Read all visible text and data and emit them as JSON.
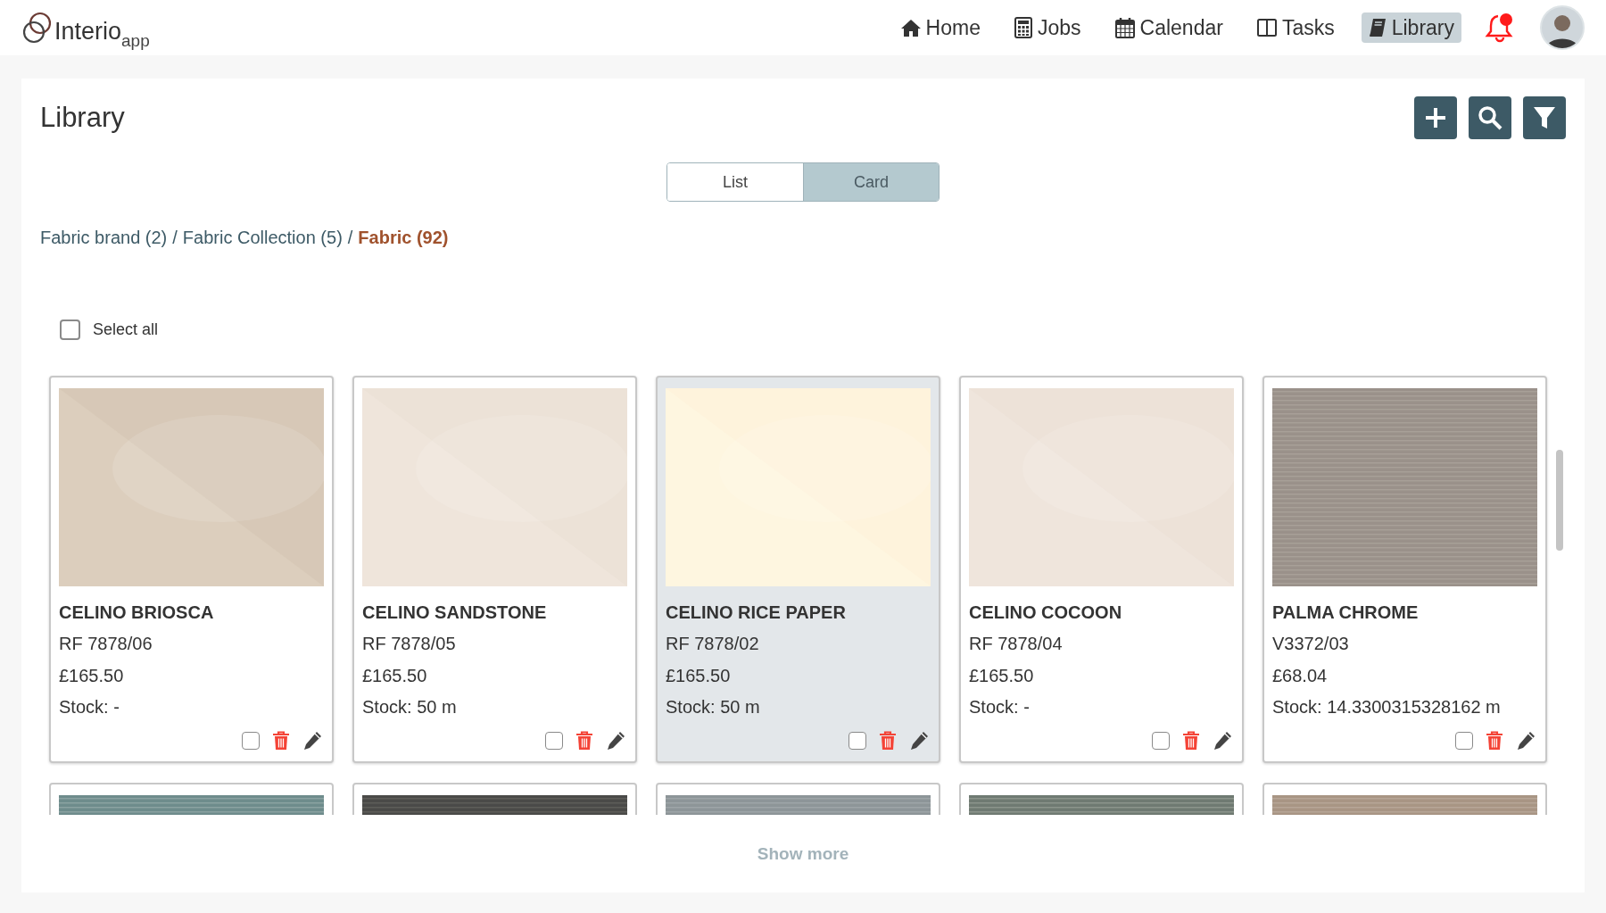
{
  "logo": {
    "name": "Interio",
    "suffix": "app"
  },
  "nav": [
    {
      "label": "Home",
      "selected": false
    },
    {
      "label": "Jobs",
      "selected": false
    },
    {
      "label": "Calendar",
      "selected": false
    },
    {
      "label": "Tasks",
      "selected": false
    },
    {
      "label": "Library",
      "selected": true
    }
  ],
  "notifications": {
    "unread": true
  },
  "page": {
    "title": "Library"
  },
  "view_toggle": [
    {
      "label": "List",
      "selected": false
    },
    {
      "label": "Card",
      "selected": true
    }
  ],
  "breadcrumb": [
    {
      "label": "Fabric brand (2)",
      "current": false
    },
    {
      "separator": "/",
      "label": "Fabric Collection (5)",
      "current": false
    },
    {
      "separator": "/",
      "label": "Fabric (92)",
      "current": true
    }
  ],
  "select_all": {
    "label": "Select all",
    "checked": false
  },
  "cards": [
    {
      "kind": "picture",
      "title": "CELINO BRIOSCA",
      "code": "RF 7878/06",
      "price": "£165.50",
      "stock": "Stock: -",
      "selected": false,
      "checked": false
    },
    {
      "kind": "picture",
      "title": "CELINO SANDSTONE",
      "code": "RF 7878/05",
      "price": "£165.50",
      "stock": "Stock: 50 m",
      "selected": false,
      "checked": false
    },
    {
      "kind": "picture",
      "title": "CELINO RICE PAPER",
      "code": "RF 7878/02",
      "price": "£165.50",
      "stock": "Stock: 50 m",
      "selected": true,
      "checked": false
    },
    {
      "kind": "picture",
      "title": "CELINO COCOON",
      "code": "RF 7878/04",
      "price": "£165.50",
      "stock": "Stock: -",
      "selected": false,
      "checked": false
    },
    {
      "kind": "picture",
      "title": "PALMA CHROME",
      "code": "V3372/03",
      "price": "£68.04",
      "stock": "Stock: 14.3300315328162 m",
      "selected": false,
      "checked": false
    }
  ],
  "show_more": "Show more"
}
